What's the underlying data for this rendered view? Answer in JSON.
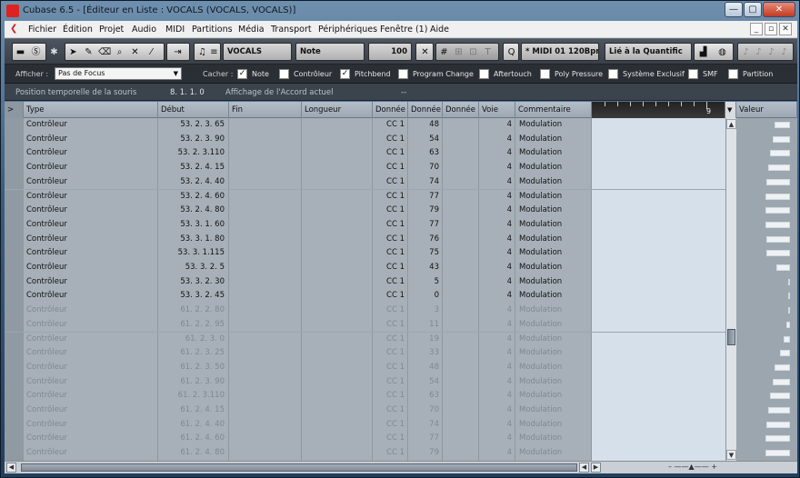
{
  "window": {
    "title": "Cubase 6.5 - [Éditeur en Liste : VOCALS (VOCALS, VOCALS)]",
    "controls": [
      "—",
      "▢",
      "✕"
    ]
  },
  "menu": [
    "Fichier",
    "Édition",
    "Projet",
    "Audio",
    "MIDI",
    "Partitions",
    "Média",
    "Transport",
    "Périphériques",
    "Fenêtre (1)",
    "Aide"
  ],
  "mdi_controls": [
    "_",
    "▫",
    "✕"
  ],
  "toolbar": {
    "track": "VOCALS",
    "insert_type": "Note",
    "velocity": "100",
    "midi_info": "* MIDI 01  120Bpm",
    "quantize": "Lié à la Quantific"
  },
  "filterbar": {
    "afficher_label": "Afficher :",
    "focus_value": "Pas de Focus",
    "cacher_label": "Cacher :",
    "options": [
      {
        "label": "Note",
        "checked": true
      },
      {
        "label": "Contrôleur",
        "checked": false
      },
      {
        "label": "Pitchbend",
        "checked": true
      },
      {
        "label": "Program Change",
        "checked": false
      },
      {
        "label": "Aftertouch",
        "checked": false
      },
      {
        "label": "Poly Pressure",
        "checked": false
      },
      {
        "label": "Système Exclusif",
        "checked": false
      },
      {
        "label": "SMF",
        "checked": false
      },
      {
        "label": "Partition",
        "checked": false
      }
    ]
  },
  "infobar": {
    "mouse_pos_label": "Position temporelle de la souris",
    "mouse_pos_value": "8. 1. 1.   0",
    "chord_label": "Affichage de l'Accord actuel",
    "chord_value": "--"
  },
  "columns": {
    "expand": ">",
    "type": "Type",
    "start": "Début",
    "end": "Fin",
    "length": "Longueur",
    "data1": "Donnée",
    "data2": "Donnée",
    "data3": "Donnée",
    "channel": "Voie",
    "comment": "Commentaire",
    "value": "Valeur"
  },
  "ruler_label": "9",
  "rows": [
    {
      "type": "Contrôleur",
      "start": "53. 2. 3. 65",
      "d1": "CC 1",
      "d2": "48",
      "ch": "4",
      "comment": "Modulation",
      "dim": false
    },
    {
      "type": "Contrôleur",
      "start": "53. 2. 3. 90",
      "d1": "CC 1",
      "d2": "54",
      "ch": "4",
      "comment": "Modulation",
      "dim": false
    },
    {
      "type": "Contrôleur",
      "start": "53. 2. 3.110",
      "d1": "CC 1",
      "d2": "63",
      "ch": "4",
      "comment": "Modulation",
      "dim": false
    },
    {
      "type": "Contrôleur",
      "start": "53. 2. 4. 15",
      "d1": "CC 1",
      "d2": "70",
      "ch": "4",
      "comment": "Modulation",
      "dim": false
    },
    {
      "type": "Contrôleur",
      "start": "53. 2. 4. 40",
      "d1": "CC 1",
      "d2": "74",
      "ch": "4",
      "comment": "Modulation",
      "dim": false
    },
    {
      "type": "Contrôleur",
      "start": "53. 2. 4. 60",
      "d1": "CC 1",
      "d2": "77",
      "ch": "4",
      "comment": "Modulation",
      "dim": false
    },
    {
      "type": "Contrôleur",
      "start": "53. 2. 4. 80",
      "d1": "CC 1",
      "d2": "79",
      "ch": "4",
      "comment": "Modulation",
      "dim": false
    },
    {
      "type": "Contrôleur",
      "start": "53. 3. 1. 60",
      "d1": "CC 1",
      "d2": "77",
      "ch": "4",
      "comment": "Modulation",
      "dim": false
    },
    {
      "type": "Contrôleur",
      "start": "53. 3. 1. 80",
      "d1": "CC 1",
      "d2": "76",
      "ch": "4",
      "comment": "Modulation",
      "dim": false
    },
    {
      "type": "Contrôleur",
      "start": "53. 3. 1.115",
      "d1": "CC 1",
      "d2": "75",
      "ch": "4",
      "comment": "Modulation",
      "dim": false
    },
    {
      "type": "Contrôleur",
      "start": "53. 3. 2.   5",
      "d1": "CC 1",
      "d2": "43",
      "ch": "4",
      "comment": "Modulation",
      "dim": false
    },
    {
      "type": "Contrôleur",
      "start": "53. 3. 2. 30",
      "d1": "CC 1",
      "d2": "5",
      "ch": "4",
      "comment": "Modulation",
      "dim": false
    },
    {
      "type": "Contrôleur",
      "start": "53. 3. 2. 45",
      "d1": "CC 1",
      "d2": "0",
      "ch": "4",
      "comment": "Modulation",
      "dim": false
    },
    {
      "type": "Contrôleur",
      "start": "61. 2. 2. 80",
      "d1": "CC 1",
      "d2": "3",
      "ch": "4",
      "comment": "Modulation",
      "dim": true
    },
    {
      "type": "Contrôleur",
      "start": "61. 2. 2. 95",
      "d1": "CC 1",
      "d2": "11",
      "ch": "4",
      "comment": "Modulation",
      "dim": true
    },
    {
      "type": "Contrôleur",
      "start": "61. 2. 3.   0",
      "d1": "CC 1",
      "d2": "19",
      "ch": "4",
      "comment": "Modulation",
      "dim": true
    },
    {
      "type": "Contrôleur",
      "start": "61. 2. 3. 25",
      "d1": "CC 1",
      "d2": "33",
      "ch": "4",
      "comment": "Modulation",
      "dim": true
    },
    {
      "type": "Contrôleur",
      "start": "61. 2. 3. 50",
      "d1": "CC 1",
      "d2": "48",
      "ch": "4",
      "comment": "Modulation",
      "dim": true
    },
    {
      "type": "Contrôleur",
      "start": "61. 2. 3. 90",
      "d1": "CC 1",
      "d2": "54",
      "ch": "4",
      "comment": "Modulation",
      "dim": true
    },
    {
      "type": "Contrôleur",
      "start": "61. 2. 3.110",
      "d1": "CC 1",
      "d2": "63",
      "ch": "4",
      "comment": "Modulation",
      "dim": true
    },
    {
      "type": "Contrôleur",
      "start": "61. 2. 4. 15",
      "d1": "CC 1",
      "d2": "70",
      "ch": "4",
      "comment": "Modulation",
      "dim": true
    },
    {
      "type": "Contrôleur",
      "start": "61. 2. 4. 40",
      "d1": "CC 1",
      "d2": "74",
      "ch": "4",
      "comment": "Modulation",
      "dim": true
    },
    {
      "type": "Contrôleur",
      "start": "61. 2. 4. 60",
      "d1": "CC 1",
      "d2": "77",
      "ch": "4",
      "comment": "Modulation",
      "dim": true
    },
    {
      "type": "Contrôleur",
      "start": "61. 2. 4. 80",
      "d1": "CC 1",
      "d2": "79",
      "ch": "4",
      "comment": "Modulation",
      "dim": true
    }
  ],
  "colors": {
    "accent": "#c22222",
    "grid_bg": "#a7b0b8",
    "timeline_bg": "#d5e0ea"
  }
}
